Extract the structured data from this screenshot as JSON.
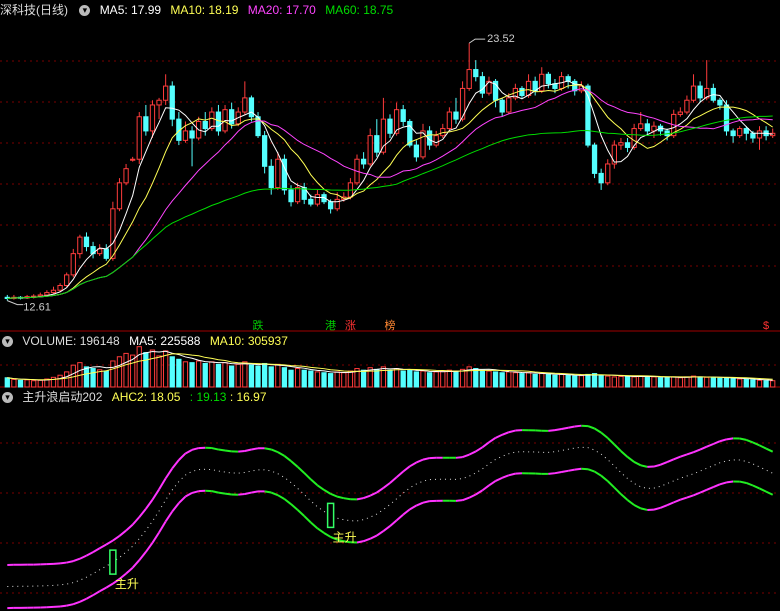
{
  "price_panel": {
    "title": "深科技(日线)",
    "ma5": {
      "label": "MA5: 17.99",
      "color": "#ffffff"
    },
    "ma10": {
      "label": "MA10: 18.19",
      "color": "#ffff55"
    },
    "ma20": {
      "label": "MA20: 17.70",
      "color": "#ff44ff"
    },
    "ma60": {
      "label": "MA60: 18.75",
      "color": "#00dd00"
    },
    "high_label": "23.52",
    "low_label": "12.61",
    "events": [
      {
        "text": "跌",
        "color": "#00cc00",
        "day": 38
      },
      {
        "text": "港",
        "color": "#00cc00",
        "day": 49
      },
      {
        "text": "涨",
        "color": "#ff3333",
        "day": 52
      },
      {
        "text": "榜",
        "color": "#ff8833",
        "day": 58
      },
      {
        "text": "$",
        "color": "#ff3333",
        "day": 115
      }
    ]
  },
  "volume_panel": {
    "title": "VOLUME: 196148",
    "ma5": {
      "label": "MA5: 225588",
      "color": "#ffffff"
    },
    "ma10": {
      "label": "MA10: 305937",
      "color": "#ffff55"
    }
  },
  "indicator_panel": {
    "title": "主升浪启动202",
    "ahc": {
      "label": "AHC2: 18.05",
      "color": "#ffff55"
    },
    "v2": {
      "label": ": 19.13",
      "color": "#00dd00"
    },
    "v3": {
      "label": ": 16.97",
      "color": "#ffff55"
    },
    "signals": [
      {
        "text": "主升",
        "day": 16
      },
      {
        "text": "主升",
        "day": 49
      }
    ]
  },
  "chart_data": {
    "type": "candlestick",
    "ylim": [
      12.0,
      24.5
    ],
    "candles": [
      [
        12.75,
        12.7,
        12.85,
        12.61
      ],
      [
        12.7,
        12.75,
        12.85,
        12.65
      ],
      [
        12.75,
        12.72,
        12.8,
        12.66
      ],
      [
        12.72,
        12.78,
        12.85,
        12.68
      ],
      [
        12.78,
        12.8,
        12.88,
        12.7
      ],
      [
        12.8,
        12.85,
        12.95,
        12.75
      ],
      [
        12.85,
        12.95,
        13.05,
        12.8
      ],
      [
        12.95,
        13.05,
        13.2,
        12.9
      ],
      [
        13.05,
        13.25,
        13.35,
        13.0
      ],
      [
        13.25,
        13.7,
        13.8,
        13.2
      ],
      [
        13.7,
        14.6,
        14.8,
        13.6
      ],
      [
        14.6,
        15.3,
        15.4,
        14.4
      ],
      [
        15.3,
        14.9,
        15.5,
        14.7
      ],
      [
        14.9,
        14.6,
        15.1,
        14.4
      ],
      [
        14.6,
        14.8,
        15.0,
        14.5
      ],
      [
        14.8,
        14.4,
        15.0,
        14.3
      ],
      [
        14.4,
        16.5,
        16.8,
        14.3
      ],
      [
        16.5,
        17.6,
        17.8,
        16.4
      ],
      [
        17.6,
        18.2,
        18.4,
        17.5
      ],
      [
        18.6,
        18.6,
        18.7,
        18.5
      ],
      [
        18.6,
        20.4,
        20.6,
        18.4
      ],
      [
        20.4,
        19.8,
        20.9,
        19.6
      ],
      [
        19.8,
        20.9,
        21.1,
        19.5
      ],
      [
        20.9,
        21.1,
        21.2,
        20.3
      ],
      [
        21.1,
        21.7,
        22.2,
        20.9
      ],
      [
        21.7,
        20.3,
        21.9,
        20.0
      ],
      [
        20.3,
        19.4,
        20.6,
        19.2
      ],
      [
        19.4,
        19.8,
        20.2,
        19.3
      ],
      [
        19.8,
        19.5,
        20.0,
        18.3
      ],
      [
        19.5,
        20.2,
        20.4,
        19.4
      ],
      [
        20.2,
        19.9,
        20.6,
        19.6
      ],
      [
        19.9,
        20.6,
        20.8,
        19.8
      ],
      [
        20.6,
        19.8,
        20.9,
        19.6
      ],
      [
        19.8,
        20.7,
        20.9,
        19.7
      ],
      [
        20.7,
        20.1,
        21.0,
        19.9
      ],
      [
        20.1,
        20.6,
        20.8,
        20.0
      ],
      [
        20.6,
        21.2,
        21.9,
        20.5
      ],
      [
        21.2,
        20.4,
        21.3,
        20.2
      ],
      [
        20.4,
        19.6,
        20.6,
        19.5
      ],
      [
        19.6,
        18.3,
        19.8,
        18.0
      ],
      [
        18.3,
        17.4,
        18.6,
        17.1
      ],
      [
        17.4,
        18.6,
        18.9,
        17.3
      ],
      [
        18.6,
        17.3,
        18.8,
        17.1
      ],
      [
        17.3,
        16.8,
        17.5,
        16.6
      ],
      [
        16.8,
        17.4,
        17.6,
        16.7
      ],
      [
        17.4,
        16.9,
        17.6,
        16.7
      ],
      [
        16.9,
        16.7,
        17.1,
        16.6
      ],
      [
        16.7,
        17.1,
        17.3,
        16.6
      ],
      [
        17.1,
        16.8,
        17.2,
        16.7
      ],
      [
        16.8,
        16.5,
        16.9,
        16.3
      ],
      [
        16.5,
        16.9,
        17.2,
        16.4
      ],
      [
        16.9,
        17.0,
        17.2,
        16.8
      ],
      [
        17.0,
        17.6,
        17.8,
        16.9
      ],
      [
        17.6,
        18.6,
        18.8,
        17.5
      ],
      [
        18.6,
        18.4,
        18.9,
        18.2
      ],
      [
        18.4,
        19.6,
        19.9,
        18.3
      ],
      [
        19.6,
        18.9,
        20.3,
        18.7
      ],
      [
        18.9,
        20.3,
        21.2,
        18.8
      ],
      [
        20.3,
        19.7,
        20.5,
        19.5
      ],
      [
        19.7,
        20.7,
        21.0,
        19.6
      ],
      [
        20.7,
        20.2,
        20.9,
        20.0
      ],
      [
        20.2,
        19.2,
        20.3,
        19.1
      ],
      [
        19.2,
        18.7,
        19.4,
        18.5
      ],
      [
        18.7,
        19.8,
        20.1,
        18.6
      ],
      [
        19.8,
        19.2,
        20.0,
        19.0
      ],
      [
        19.2,
        19.6,
        19.8,
        19.1
      ],
      [
        19.6,
        19.9,
        20.1,
        19.5
      ],
      [
        19.9,
        20.6,
        20.8,
        19.8
      ],
      [
        20.6,
        20.3,
        21.2,
        20.1
      ],
      [
        20.3,
        21.6,
        21.9,
        20.2
      ],
      [
        21.6,
        22.4,
        23.52,
        21.5
      ],
      [
        22.4,
        22.1,
        22.8,
        21.9
      ],
      [
        22.1,
        21.4,
        22.3,
        21.2
      ],
      [
        21.4,
        21.9,
        22.1,
        21.3
      ],
      [
        21.9,
        21.1,
        22.0,
        20.8
      ],
      [
        21.1,
        20.6,
        21.2,
        20.4
      ],
      [
        20.6,
        21.2,
        21.4,
        20.5
      ],
      [
        21.2,
        21.6,
        21.8,
        21.1
      ],
      [
        21.6,
        21.3,
        21.7,
        21.2
      ],
      [
        21.3,
        21.9,
        22.2,
        21.2
      ],
      [
        21.9,
        21.5,
        22.1,
        21.3
      ],
      [
        21.5,
        22.2,
        22.5,
        21.4
      ],
      [
        22.2,
        21.8,
        22.3,
        21.6
      ],
      [
        21.8,
        21.6,
        22.0,
        21.4
      ],
      [
        21.6,
        22.1,
        22.3,
        21.5
      ],
      [
        22.1,
        21.9,
        22.2,
        21.6
      ],
      [
        21.9,
        21.5,
        22.0,
        21.3
      ],
      [
        21.5,
        21.7,
        21.9,
        21.4
      ],
      [
        21.7,
        19.2,
        21.8,
        19.1
      ],
      [
        19.2,
        18.0,
        19.3,
        17.8
      ],
      [
        18.0,
        17.6,
        18.2,
        17.3
      ],
      [
        17.6,
        18.4,
        18.6,
        17.5
      ],
      [
        18.4,
        19.2,
        19.4,
        18.2
      ],
      [
        19.2,
        19.3,
        19.5,
        19.0
      ],
      [
        19.3,
        19.1,
        19.5,
        18.9
      ],
      [
        19.1,
        19.9,
        20.1,
        19.0
      ],
      [
        19.9,
        20.1,
        20.6,
        19.8
      ],
      [
        20.1,
        19.8,
        20.3,
        19.6
      ],
      [
        19.8,
        20.0,
        20.2,
        19.5
      ],
      [
        20.0,
        19.8,
        20.1,
        19.6
      ],
      [
        19.8,
        19.6,
        19.9,
        19.4
      ],
      [
        19.6,
        20.5,
        20.7,
        19.5
      ],
      [
        20.5,
        20.6,
        20.8,
        20.4
      ],
      [
        20.6,
        21.1,
        21.3,
        20.5
      ],
      [
        21.1,
        21.7,
        22.2,
        21.0
      ],
      [
        21.7,
        21.2,
        21.9,
        21.0
      ],
      [
        21.2,
        21.6,
        22.8,
        21.1
      ],
      [
        21.6,
        21.1,
        21.8,
        21.0
      ],
      [
        21.1,
        20.9,
        21.2,
        20.7
      ],
      [
        20.9,
        19.8,
        21.1,
        19.6
      ],
      [
        19.8,
        19.6,
        19.9,
        19.3
      ],
      [
        19.6,
        19.9,
        20.0,
        19.5
      ],
      [
        19.9,
        19.7,
        20.0,
        19.4
      ],
      [
        19.7,
        19.5,
        19.8,
        19.3
      ],
      [
        19.5,
        19.8,
        20.0,
        19.0
      ],
      [
        19.8,
        19.6,
        20.0,
        19.4
      ],
      [
        19.6,
        19.7,
        19.9,
        19.5
      ]
    ],
    "volume": [
      22,
      18,
      16,
      17,
      15,
      16,
      19,
      23,
      28,
      36,
      52,
      58,
      48,
      44,
      41,
      38,
      62,
      72,
      80,
      76,
      96,
      82,
      88,
      74,
      86,
      72,
      66,
      60,
      58,
      62,
      56,
      60,
      54,
      58,
      50,
      54,
      60,
      52,
      50,
      56,
      48,
      54,
      46,
      40,
      44,
      40,
      38,
      36,
      34,
      32,
      36,
      34,
      38,
      44,
      40,
      46,
      42,
      48,
      40,
      44,
      38,
      40,
      36,
      38,
      34,
      36,
      38,
      40,
      36,
      42,
      48,
      44,
      40,
      38,
      36,
      34,
      36,
      34,
      32,
      34,
      30,
      32,
      30,
      28,
      30,
      28,
      26,
      27,
      30,
      32,
      28,
      26,
      24,
      25,
      26,
      24,
      26,
      25,
      24,
      22,
      23,
      24,
      22,
      24,
      26,
      24,
      23,
      22,
      21,
      22,
      20,
      19,
      18,
      17,
      16,
      15,
      15
    ]
  }
}
